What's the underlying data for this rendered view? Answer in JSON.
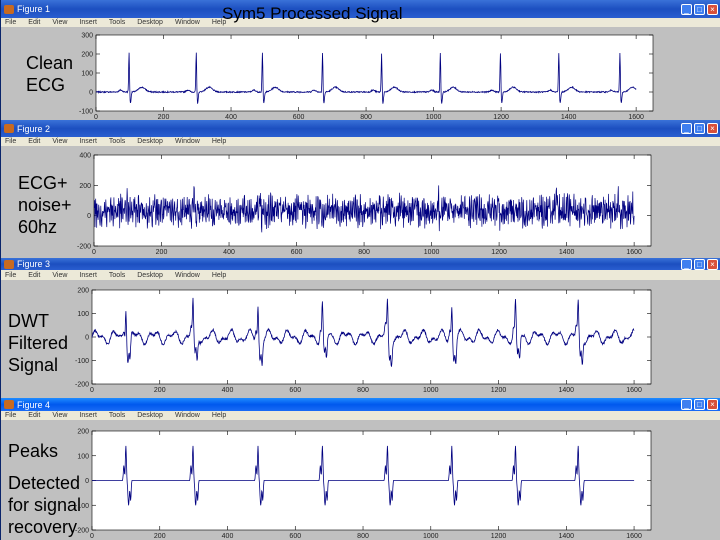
{
  "slide": {
    "title": "Sym5 Processed Signal"
  },
  "menu": [
    "File",
    "Edit",
    "View",
    "Insert",
    "Tools",
    "Desktop",
    "Window",
    "Help"
  ],
  "window_buttons": {
    "minimize": "_",
    "maximize": "□",
    "close": "×"
  },
  "figures": [
    {
      "title": "Figure 1",
      "label": [
        "Clean",
        "ECG"
      ],
      "yticks": [
        "300",
        "200",
        "100",
        "0",
        "-100"
      ],
      "xticks": [
        "0",
        "200",
        "400",
        "600",
        "800",
        "1000",
        "1200",
        "1400",
        "1600"
      ],
      "ylim": [
        -100,
        300
      ],
      "xlim": [
        0,
        1650
      ],
      "kind": "clean"
    },
    {
      "title": "Figure 2",
      "label": [
        "ECG+",
        "noise+",
        "60hz"
      ],
      "yticks": [
        "400",
        "200",
        "0",
        "-200"
      ],
      "xticks": [
        "0",
        "200",
        "400",
        "600",
        "800",
        "1000",
        "1200",
        "1400",
        "1600"
      ],
      "ylim": [
        -200,
        400
      ],
      "xlim": [
        0,
        1650
      ],
      "kind": "noisy"
    },
    {
      "title": "Figure 3",
      "label": [
        "DWT",
        "Filtered",
        "Signal"
      ],
      "yticks": [
        "200",
        "100",
        "0",
        "-100",
        "-200"
      ],
      "xticks": [
        "0",
        "200",
        "400",
        "600",
        "800",
        "1000",
        "1200",
        "1400",
        "1600"
      ],
      "ylim": [
        -200,
        200
      ],
      "xlim": [
        0,
        1650
      ],
      "kind": "dwt"
    },
    {
      "title": "Figure 4",
      "label": [
        "Peaks",
        "Detected",
        "for signal",
        "recovery"
      ],
      "yticks": [
        "200",
        "100",
        "0",
        "-100",
        "-200"
      ],
      "xticks": [
        "0",
        "200",
        "400",
        "600",
        "800",
        "1000",
        "1200",
        "1400",
        "1600"
      ],
      "ylim": [
        -200,
        200
      ],
      "xlim": [
        0,
        1650
      ],
      "kind": "peaks"
    }
  ],
  "chart_data": {
    "type": "line",
    "r_peak_samples": [
      98,
      297,
      493,
      671,
      846,
      1020,
      1198,
      1371,
      1552
    ],
    "series_color": "#000080"
  }
}
